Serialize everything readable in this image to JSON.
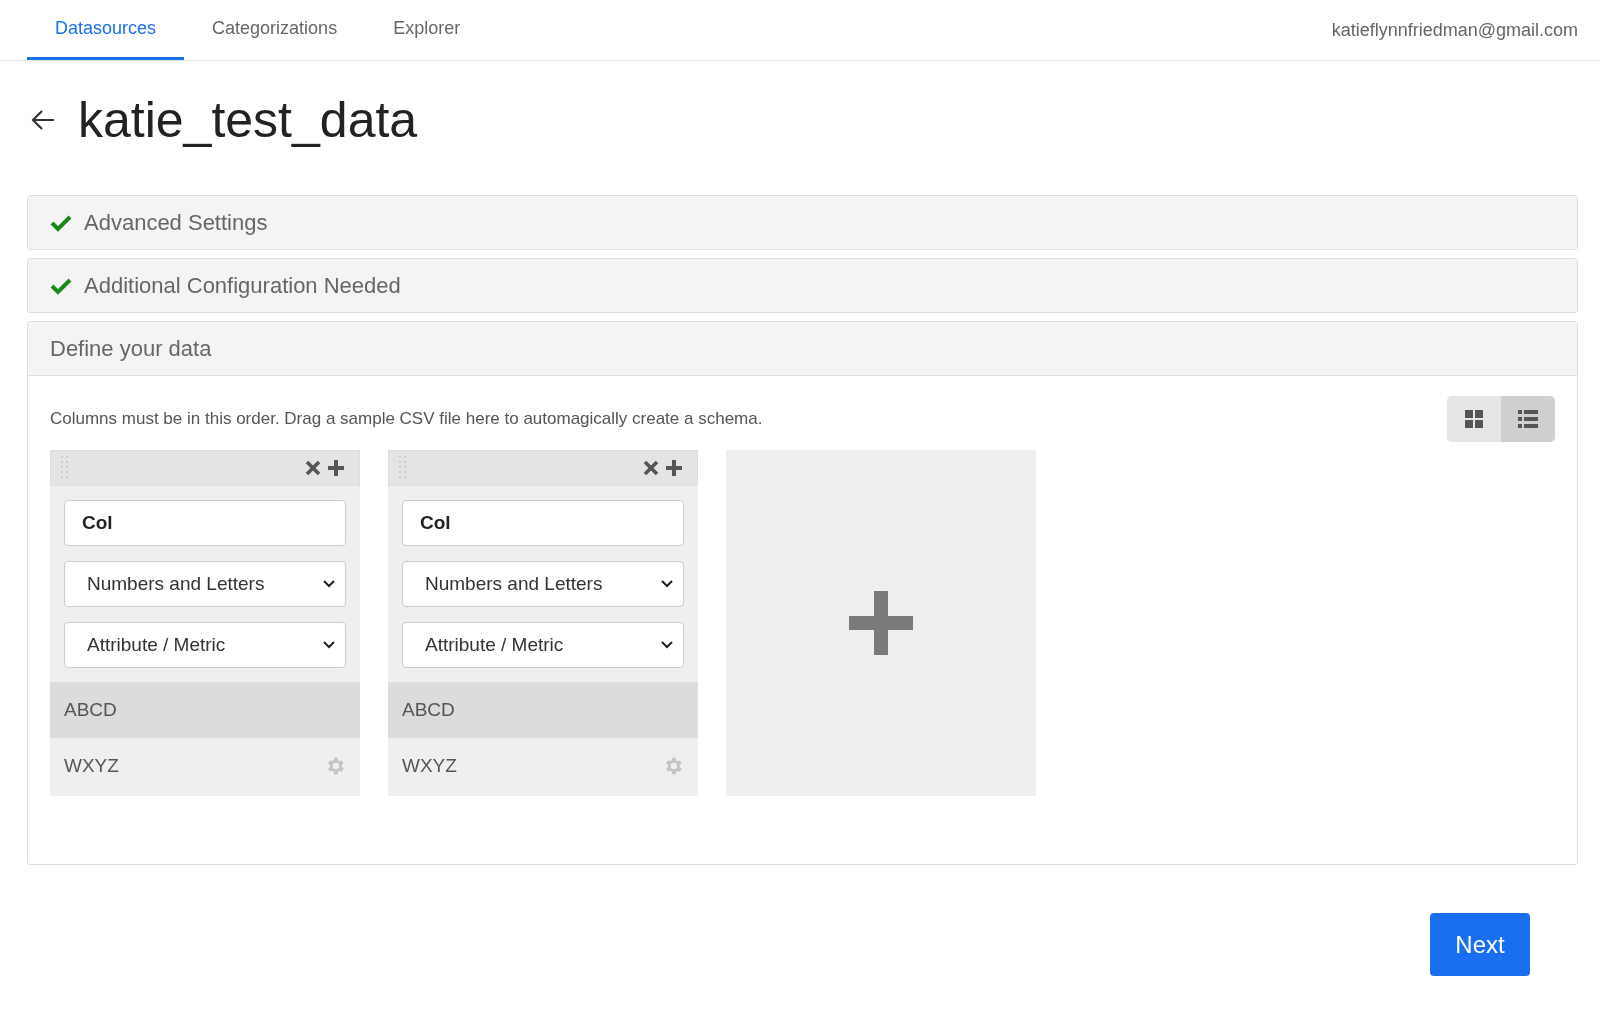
{
  "nav": {
    "tabs": [
      {
        "label": "Datasources",
        "selected": true
      },
      {
        "label": "Categorizations",
        "selected": false
      },
      {
        "label": "Explorer",
        "selected": false
      }
    ],
    "user_email": "katieflynnfriedman@gmail.com"
  },
  "page_title": "katie_test_data",
  "sections": [
    {
      "title": "Advanced Settings",
      "complete": true,
      "expanded": false
    },
    {
      "title": "Additional Configuration Needed",
      "complete": true,
      "expanded": false
    },
    {
      "title": "Define your data",
      "complete": false,
      "expanded": true
    }
  ],
  "define": {
    "hint": "Columns must be in this order. Drag a sample CSV file here to automagically create a schema.",
    "view_toggle": [
      {
        "kind": "grid",
        "selected": false
      },
      {
        "kind": "list",
        "selected": true
      }
    ],
    "columns": [
      {
        "name": "Col",
        "type": "Numbers and Letters",
        "role": "Attribute / Metric",
        "samples": [
          {
            "kind": "header",
            "text": "ABCD"
          },
          {
            "kind": "value",
            "text": "WXYZ"
          }
        ]
      },
      {
        "name": "Col",
        "type": "Numbers and Letters",
        "role": "Attribute / Metric",
        "samples": [
          {
            "kind": "header",
            "text": "ABCD"
          },
          {
            "kind": "value",
            "text": "WXYZ"
          }
        ]
      }
    ]
  },
  "next_button": "Next"
}
